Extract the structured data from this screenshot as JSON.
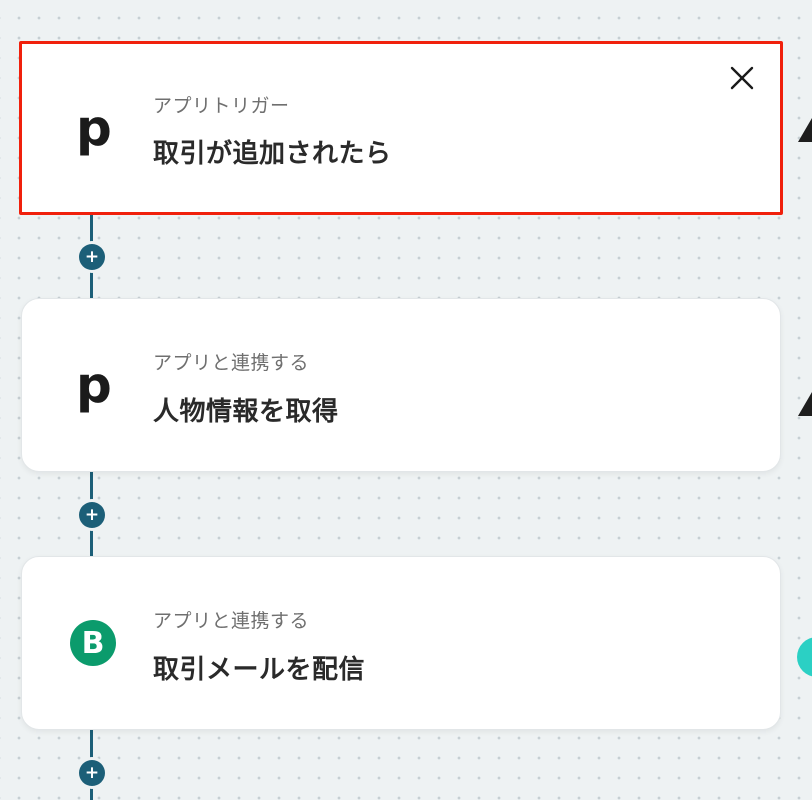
{
  "steps": [
    {
      "type_label": "アプリトリガー",
      "title": "取引が追加されたら",
      "app_icon": "pipedrive-icon",
      "app_letter": "p"
    },
    {
      "type_label": "アプリと連携する",
      "title": "人物情報を取得",
      "app_icon": "pipedrive-icon",
      "app_letter": "p"
    },
    {
      "type_label": "アプリと連携する",
      "title": "取引メールを配信",
      "app_icon": "brevo-icon",
      "app_letter": "B"
    }
  ],
  "add_step_symbol": "+",
  "colors": {
    "connector": "#1c5f78",
    "selected_border": "#f0200c",
    "brevo_green": "#0b9b6c",
    "teal_accent": "#2bd0c4"
  }
}
